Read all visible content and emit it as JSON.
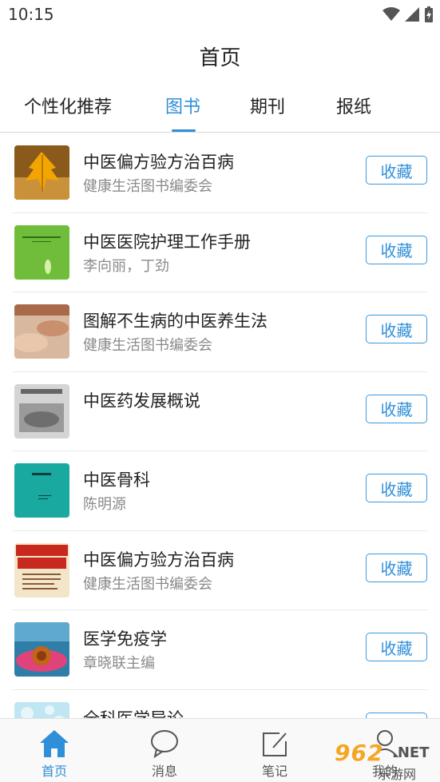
{
  "status": {
    "time": "10:15"
  },
  "header": {
    "title": "首页"
  },
  "tabs": [
    {
      "label": "个性化推荐"
    },
    {
      "label": "图书"
    },
    {
      "label": "期刊"
    },
    {
      "label": "报纸"
    }
  ],
  "active_tab": "图书",
  "books": [
    {
      "title": "中医偏方验方治百病",
      "author": "健康生活图书编委会",
      "button": "收藏",
      "cover": "autumn-leaf"
    },
    {
      "title": "中医医院护理工作手册",
      "author": "李向丽，丁劲",
      "button": "收藏",
      "cover": "green-cover"
    },
    {
      "title": "图解不生病的中医养生法",
      "author": "健康生活图书编委会",
      "button": "收藏",
      "cover": "hands-massage"
    },
    {
      "title": "中医药发展概说",
      "author": "",
      "button": "收藏",
      "cover": "herbs-grey"
    },
    {
      "title": "中医骨科",
      "author": "陈明源",
      "button": "收藏",
      "cover": "teal-cover"
    },
    {
      "title": "中医偏方验方治百病",
      "author": "健康生活图书编委会",
      "button": "收藏",
      "cover": "red-text-cover"
    },
    {
      "title": "医学免疫学",
      "author": "章晓联主编",
      "button": "收藏",
      "cover": "echinacea-flower"
    },
    {
      "title": "全科医学导论",
      "author": "",
      "button": "收藏",
      "cover": "blue-bubbles"
    }
  ],
  "nav": [
    {
      "label": "首页",
      "icon": "home-icon",
      "active": true
    },
    {
      "label": "消息",
      "icon": "message-icon",
      "active": false
    },
    {
      "label": "笔记",
      "icon": "note-icon",
      "active": false
    },
    {
      "label": "我的",
      "icon": "user-icon",
      "active": false
    }
  ],
  "watermark": {
    "number": "962",
    "net": ".NET",
    "sub": "乐游网"
  },
  "colors": {
    "accent": "#2f8fd8",
    "text": "#222222",
    "secondary": "#8a8a8a"
  }
}
